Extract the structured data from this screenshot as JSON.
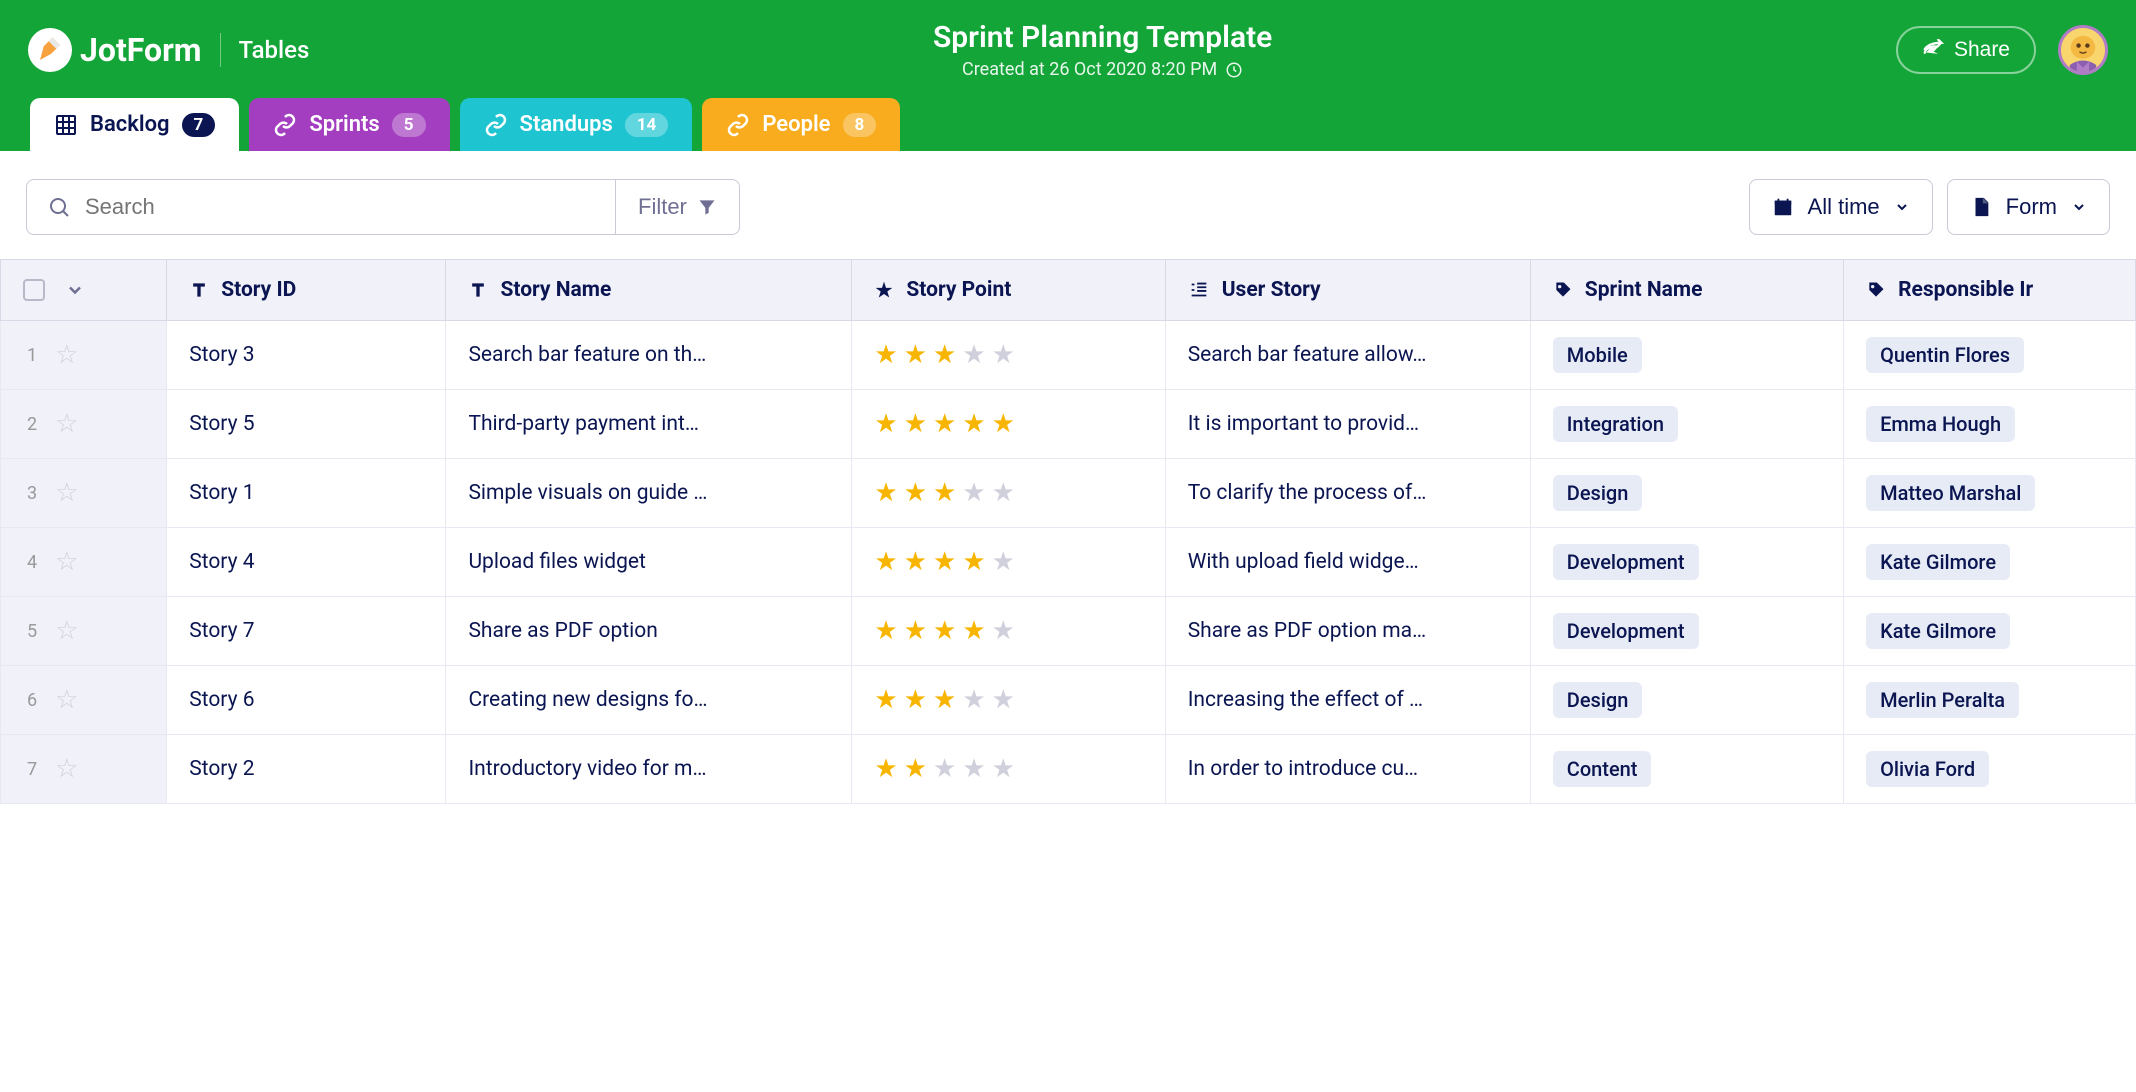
{
  "brand": {
    "name": "JotForm",
    "section": "Tables"
  },
  "header": {
    "title": "Sprint Planning Template",
    "created": "Created at 26 Oct 2020 8:20 PM",
    "share": "Share"
  },
  "tabs": [
    {
      "label": "Backlog",
      "count": "7"
    },
    {
      "label": "Sprints",
      "count": "5"
    },
    {
      "label": "Standups",
      "count": "14"
    },
    {
      "label": "People",
      "count": "8"
    }
  ],
  "toolbar": {
    "search_placeholder": "Search",
    "filter": "Filter",
    "all_time": "All time",
    "form": "Form"
  },
  "columns": {
    "story_id": "Story ID",
    "story_name": "Story Name",
    "story_point": "Story Point",
    "user_story": "User Story",
    "sprint_name": "Sprint Name",
    "responsible": "Responsible Ir"
  },
  "rows": [
    {
      "n": "1",
      "id": "Story 3",
      "name": "Search bar feature on th…",
      "pts": 3,
      "us": "Search bar feature allow…",
      "sprint": "Mobile",
      "resp": "Quentin Flores"
    },
    {
      "n": "2",
      "id": "Story 5",
      "name": "Third-party payment int…",
      "pts": 5,
      "us": "It is important to provid…",
      "sprint": "Integration",
      "resp": "Emma Hough"
    },
    {
      "n": "3",
      "id": "Story 1",
      "name": "Simple visuals on guide …",
      "pts": 3,
      "us": "To clarify the process of…",
      "sprint": "Design",
      "resp": "Matteo Marshal"
    },
    {
      "n": "4",
      "id": "Story 4",
      "name": "Upload files widget",
      "pts": 4,
      "us": "With upload field widge…",
      "sprint": "Development",
      "resp": "Kate Gilmore"
    },
    {
      "n": "5",
      "id": "Story 7",
      "name": "Share as PDF option",
      "pts": 4,
      "us": "Share as PDF option ma…",
      "sprint": "Development",
      "resp": "Kate Gilmore"
    },
    {
      "n": "6",
      "id": "Story 6",
      "name": "Creating new designs fo…",
      "pts": 3,
      "us": "Increasing the effect of …",
      "sprint": "Design",
      "resp": "Merlin Peralta"
    },
    {
      "n": "7",
      "id": "Story 2",
      "name": "Introductory video for m…",
      "pts": 2,
      "us": "In order to introduce cu…",
      "sprint": "Content",
      "resp": "Olivia Ford"
    }
  ]
}
